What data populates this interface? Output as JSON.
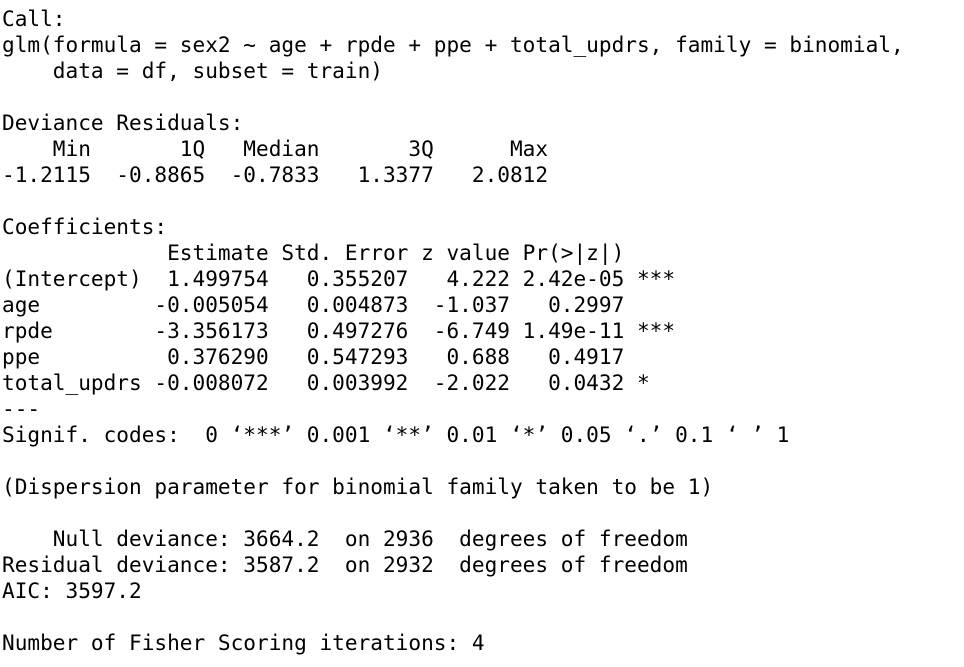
{
  "output": {
    "lines": [
      "Call:",
      "glm(formula = sex2 ~ age + rpde + ppe + total_updrs, family = binomial,",
      "    data = df, subset = train)",
      "",
      "Deviance Residuals:",
      "    Min       1Q   Median       3Q      Max",
      "-1.2115  -0.8865  -0.7833   1.3377   2.0812",
      "",
      "Coefficients:",
      "             Estimate Std. Error z value Pr(>|z|)    ",
      "(Intercept)  1.499754   0.355207   4.222 2.42e-05 ***",
      "age         -0.005054   0.004873  -1.037   0.2997    ",
      "rpde        -3.356173   0.497276  -6.749 1.49e-11 ***",
      "ppe          0.376290   0.547293   0.688   0.4917    ",
      "total_updrs -0.008072   0.003992  -2.022   0.0432 *  ",
      "---",
      "Signif. codes:  0 ‘***’ 0.001 ‘**’ 0.01 ‘*’ 0.05 ‘.’ 0.1 ‘ ’ 1",
      "",
      "(Dispersion parameter for binomial family taken to be 1)",
      "",
      "    Null deviance: 3664.2  on 2936  degrees of freedom",
      "Residual deviance: 3587.2  on 2932  degrees of freedom",
      "AIC: 3597.2",
      "",
      "Number of Fisher Scoring iterations: 4"
    ]
  }
}
